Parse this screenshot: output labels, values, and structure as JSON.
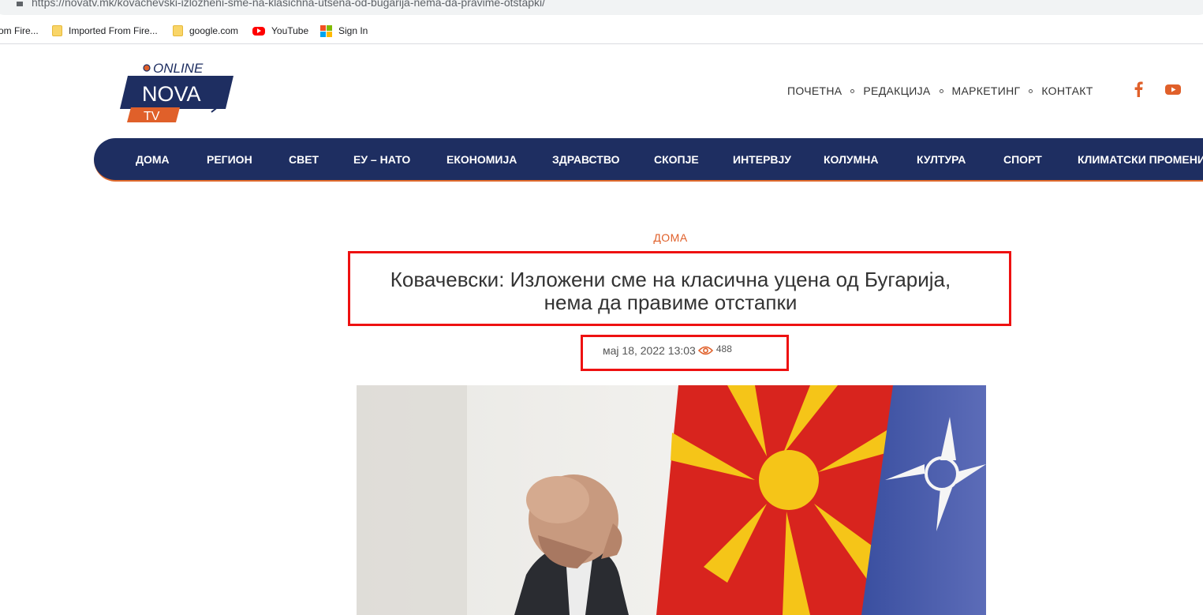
{
  "browser": {
    "url": "https://novatv.mk/kovachevski-izlozheni-sme-na-klasichna-utsena-od-bugarija-nema-da-pravime-otstapki/",
    "bookmarks": [
      {
        "label": "om Fire...",
        "icon": "none"
      },
      {
        "label": "Imported From Fire...",
        "icon": "folder-icon"
      },
      {
        "label": "google.com",
        "icon": "folder-icon"
      },
      {
        "label": "YouTube",
        "icon": "youtube-icon"
      },
      {
        "label": "Sign In",
        "icon": "microsoft-icon"
      }
    ]
  },
  "logo": {
    "online": "ONLINE",
    "nova": "NOVA",
    "tv": "TV"
  },
  "top_nav": [
    "ПОЧЕТНА",
    "РЕДАКЦИЈА",
    "МАРКЕТИНГ",
    "КОНТАКТ"
  ],
  "main_nav": [
    "ДОМА",
    "РЕГИОН",
    "СВЕТ",
    "ЕУ – НАТО",
    "ЕКОНОМИЈА",
    "ЗДРАВСТВО",
    "СКОПЈЕ",
    "ИНТЕРВЈУ",
    "КОЛУМНА",
    "КУЛТУРА",
    "СПОРТ",
    "КЛИМАТСКИ ПРОМЕНИ"
  ],
  "article": {
    "category": "ДОМА",
    "title_line1": "Ковачевски: Изложени сме на класична уцена од Бугарија,",
    "title_line2": "нема да правиме отстапки",
    "date": "мај 18, 2022 13:03",
    "views": "488"
  },
  "colors": {
    "navy": "#1e2e61",
    "accent": "#e0602a",
    "highlight_box": "#ee1111"
  }
}
